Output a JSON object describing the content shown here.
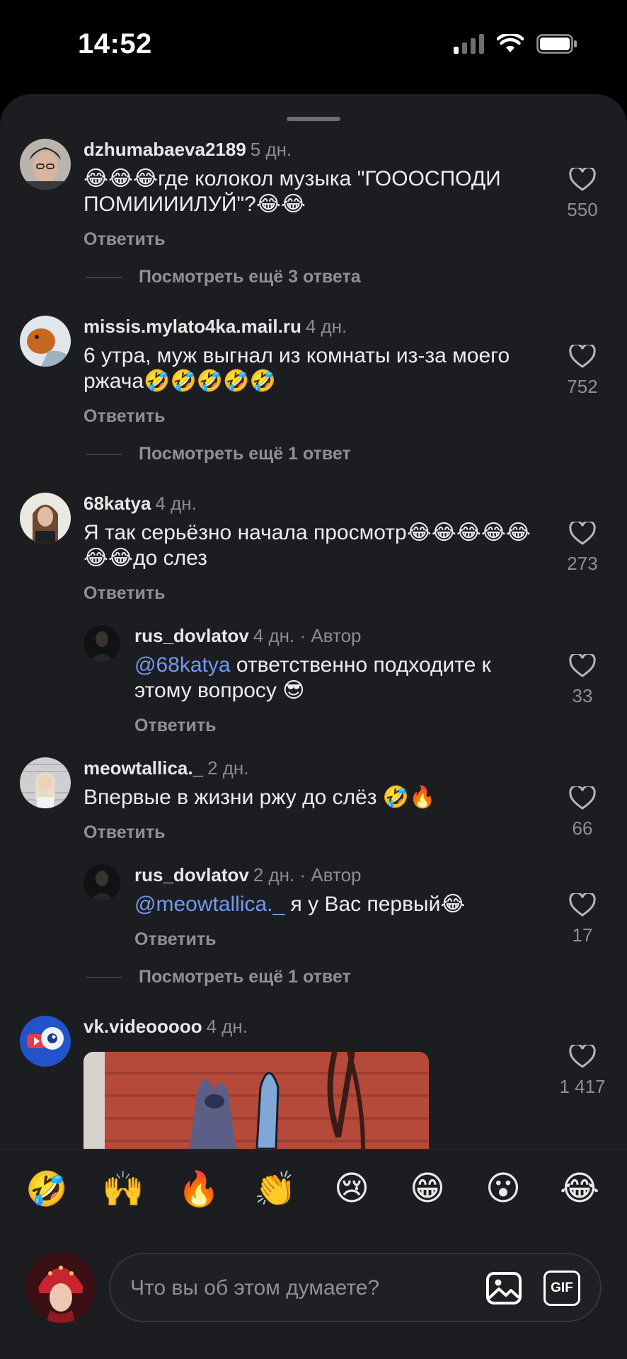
{
  "status": {
    "time": "14:52"
  },
  "comments": [
    {
      "user": "dzhumabaeva2189",
      "time": "5 дн.",
      "text": "😂😂😂где колокол музыка \"ГОООСПОДИ ПОМИИИИЛУЙ\"?😂😂",
      "reply": "Ответить",
      "likes": "550",
      "more": "Посмотреть ещё 3 ответа"
    },
    {
      "user": "missis.mylato4ka.mail.ru",
      "time": "4 дн.",
      "text": "6 утра, муж выгнал из комнаты из-за моего ржача🤣🤣🤣🤣🤣",
      "reply": "Ответить",
      "likes": "752",
      "more": "Посмотреть ещё 1 ответ"
    },
    {
      "user": "68katya",
      "time": "4 дн.",
      "text": "Я так серьёзно начала просмотр😂😂😂😂😂😂😂до слез",
      "reply": "Ответить",
      "likes": "273"
    },
    {
      "user": "rus_dovlatov",
      "time": "4 дн. · Автор",
      "mention": "@68katya",
      "text": " ответственно подходите к этому вопросу 😎",
      "reply": "Ответить",
      "likes": "33"
    },
    {
      "user": "meowtallica._",
      "time": "2 дн.",
      "text": "Впервые в жизни ржу до слёз 🤣🔥",
      "reply": "Ответить",
      "likes": "66"
    },
    {
      "user": "rus_dovlatov",
      "time": "2 дн. · Автор",
      "mention": "@meowtallica._",
      "text": " я у Вас первый😂",
      "reply": "Ответить",
      "likes": "17",
      "more": "Посмотреть ещё 1 ответ"
    },
    {
      "user": "vk.videooooo",
      "time": "4 дн.",
      "likes": "1 417"
    }
  ],
  "emoji_bar": [
    "🤣",
    "🙌",
    "🔥",
    "👏",
    "😢",
    "😁",
    "😮",
    "😂"
  ],
  "composer": {
    "placeholder": "Что вы об этом думаете?",
    "gif_label": "GIF"
  },
  "colors": {
    "background": "#1c1d20",
    "mention": "#7199f0",
    "muted": "#8f9095"
  }
}
